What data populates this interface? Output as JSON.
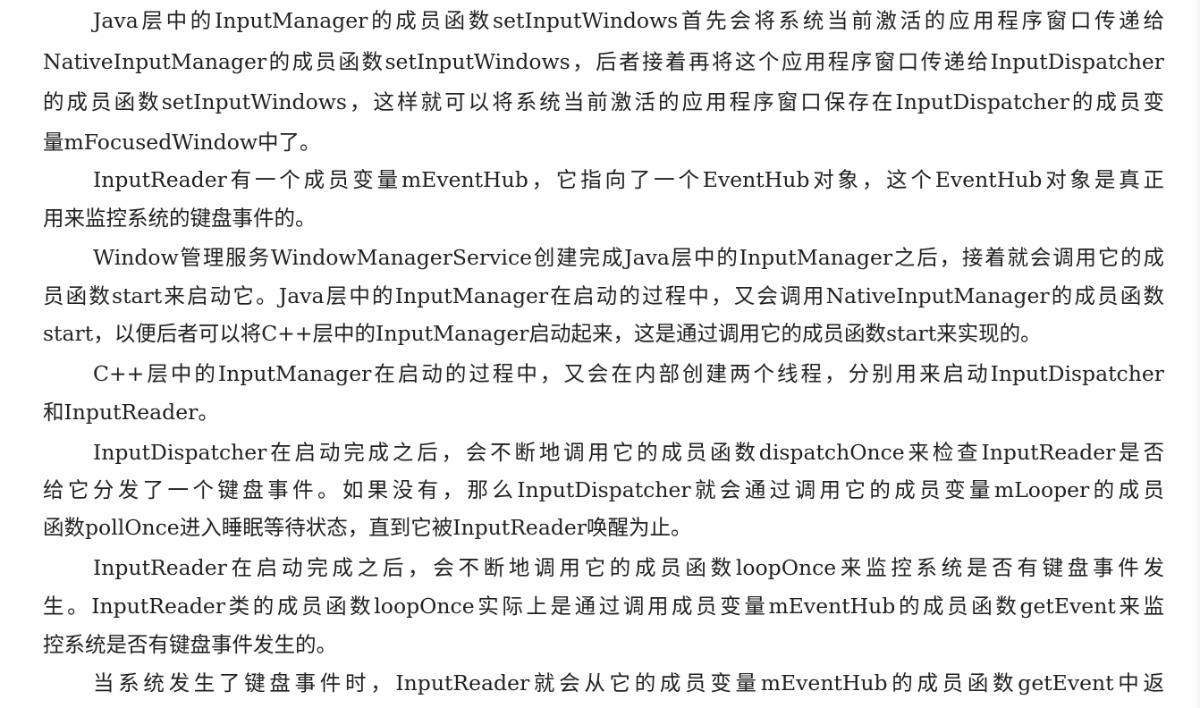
{
  "document": {
    "paragraphs": [
      {
        "lines": [
          "Java层中的InputManager的成员函数setInputWindows首先会将系统当前激活的应用程序窗口传递给",
          "NativeInputManager的成员函数setInputWindows，后者接着再将这个应用程序窗口传递给InputDispatcher",
          "的成员函数setInputWindows，这样就可以将系统当前激活的应用程序窗口保存在InputDispatcher的成员变",
          "量mFocusedWindow中了。"
        ]
      },
      {
        "lines": [
          "InputReader有一个成员变量mEventHub，它指向了一个EventHub对象，这个EventHub对象是真正",
          "用来监控系统的键盘事件的。"
        ]
      },
      {
        "lines": [
          "Window管理服务WindowManagerService创建完成Java层中的InputManager之后，接着就会调用它的成",
          "员函数start来启动它。Java层中的InputManager在启动的过程中，又会调用NativeInputManager的成员函数",
          "start，以便后者可以将C++层中的InputManager启动起来，这是通过调用它的成员函数start来实现的。"
        ]
      },
      {
        "lines": [
          "C++层中的InputManager在启动的过程中，又会在内部创建两个线程，分别用来启动InputDispatcher",
          "和InputReader。"
        ]
      },
      {
        "lines": [
          "InputDispatcher在启动完成之后，会不断地调用它的成员函数dispatchOnce来检查InputReader是否",
          "给它分发了一个键盘事件。如果没有，那么InputDispatcher就会通过调用它的成员变量mLooper的成员",
          "函数pollOnce进入睡眠等待状态，直到它被InputReader唤醒为止。"
        ]
      },
      {
        "lines": [
          "InputReader在启动完成之后，会不断地调用它的成员函数loopOnce来监控系统是否有键盘事件发",
          "生。InputReader类的成员函数loopOnce实际上是通过调用成员变量mEventHub的成员函数getEvent来监",
          "控系统是否有键盘事件发生的。"
        ]
      },
      {
        "lines": [
          "当系统发生了键盘事件时，InputReader就会从它的成员变量mEventHub的成员函数getEvent中返"
        ]
      }
    ]
  }
}
